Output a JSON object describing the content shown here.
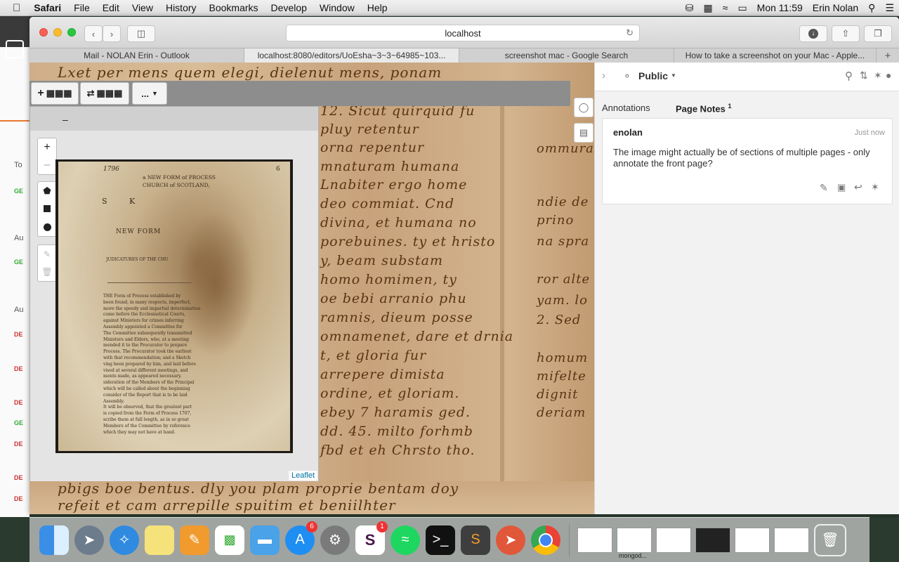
{
  "menubar": {
    "app": "Safari",
    "items": [
      "File",
      "Edit",
      "View",
      "History",
      "Bookmarks",
      "Develop",
      "Window",
      "Help"
    ],
    "clock": "Mon 11:59",
    "user": "Erin Nolan"
  },
  "browser": {
    "url": "localhost",
    "tabs": [
      "Mail - NOLAN Erin - Outlook",
      "localhost:8080/editors/UoEsha~3~3~64985~103...",
      "screenshot mac - Google Search",
      "How to take a screenshot on your Mac - Apple..."
    ],
    "active_tab": 1
  },
  "viewer": {
    "toolbar": {
      "add_label": "+",
      "swap_label": "⇄",
      "more_label": "..."
    },
    "minimize": "–",
    "zoom_in": "+",
    "zoom_out": "–",
    "attribution": "Leaflet",
    "page_number": "6",
    "page_lines": {
      "header1": "a NEW FORM of PROCESS",
      "header2": "CHURCH of SCOTLAND,",
      "title1": "S   K",
      "title2": "NEW FORM",
      "title3": "JUDICATURES OF THE CHU",
      "body": [
        "THE Form of Process established by",
        "been found, in many respects, imperfect,",
        "more the speedy and impartial determination",
        "come before the Ecclesiastical Courts,",
        "against Ministers for crimes inferring",
        "Assembly appointed a Committee for",
        "The Committee subsequently transmitted",
        "Ministers and Elders, who, at a meeting",
        "mended it to the Procurator to prepare",
        "Process. The Procurator took the earliest",
        "with that recommendation; and a Sketch",
        "ving been prepared by him, and laid before",
        "vised at several different meetings, and",
        "ments made, as appeared necessary.",
        "sideration of the Members of the Principal",
        "which will be called about the beginning",
        "consider of the Report that is to be laid",
        "Assembly.",
        "It will be observed, that the greatest part",
        "is copied from the Form of Process 1707,",
        "scribe them at full length, as in so great",
        "Members of the Committee by reference",
        "which they may not have at hand."
      ]
    }
  },
  "manuscript_text": [
    "Lxet per mens quem elegi, dielenut mens, ponam",
    "12. Sicut quirquid fu",
    "pluy retentur",
    "orna repentur",
    "mnaturam humana",
    "Lnabiter ergo home",
    "deo commiat. Cnd",
    "divina, et humana no",
    "porebuines. ty et hristo",
    "y, beam substam",
    "homo homimen, ty",
    "oe bebi arranio phu",
    "ramnis, dieum posse",
    "omnamenet, dare et drnia",
    "t, et gloria fur",
    "arrepere dimista",
    "ordine, et gloriam.",
    "ebey 7 haramis ged.",
    "dd. 45. milto forhmb",
    "fbd et eh Chrsto tho.",
    "pbigs boe bentus. dly you plam proprie bentam doy",
    "refeit et cam arrepille spuitim et beniilhter",
    "ommura",
    "ndie de",
    "prino",
    "na spra",
    "ror alte",
    "yam. lo",
    "2. Sed",
    "homum",
    "mifelte",
    "dignit",
    "deriam"
  ],
  "hypothesis": {
    "scope": "Public",
    "tab_annotations": "Annotations",
    "tab_page_notes": "Page Notes",
    "page_notes_count": "1",
    "note": {
      "user": "enolan",
      "time": "Just now",
      "text": "The image might actually be of sections of multiple pages - only annotate the front page?"
    }
  },
  "dock": {
    "appstore_badge": "6",
    "slack_badge": "1",
    "mongo_label": "mongod..."
  },
  "colors": {
    "accent_link": "#0078a8",
    "hypothesis_text": "#202020",
    "badge": "#e33333"
  }
}
